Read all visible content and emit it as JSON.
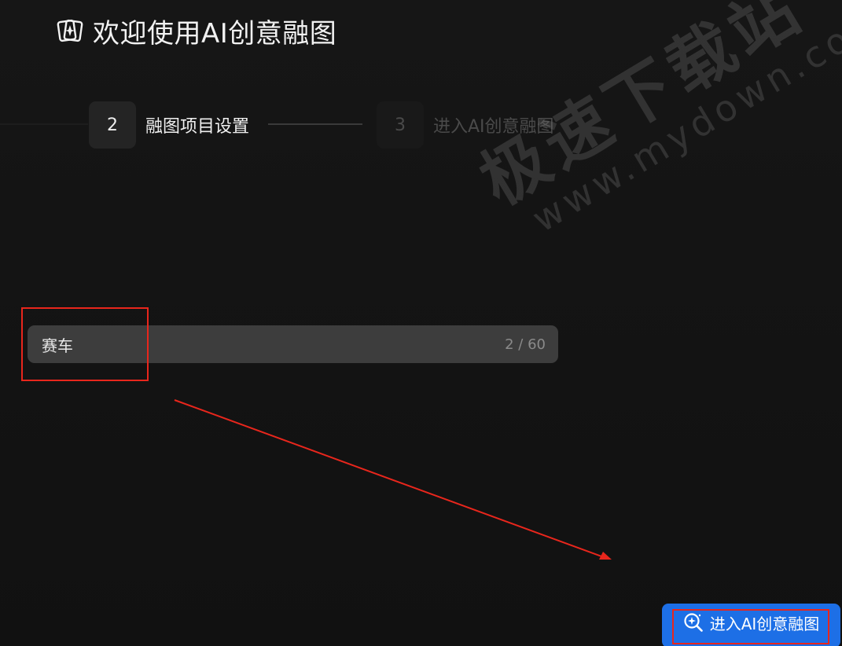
{
  "header": {
    "title": "欢迎使用AI创意融图",
    "logo_icon": "sparkle-frame-icon"
  },
  "stepper": {
    "steps": [
      {
        "number": "2",
        "label": "融图项目设置",
        "state": "active"
      },
      {
        "number": "3",
        "label": "进入AI创意融图",
        "state": "inactive"
      }
    ]
  },
  "watermark": {
    "site_name": "极速下载站",
    "url": "www.mydown.com"
  },
  "project_input": {
    "value": "赛车",
    "char_count": "2 / 60"
  },
  "actions": {
    "enter_label": "进入AI创意融图",
    "enter_icon": "zoom-sparkle-icon"
  },
  "colors": {
    "background": "#121212",
    "primary": "#1d6fe6",
    "annotation": "#e8261c"
  }
}
